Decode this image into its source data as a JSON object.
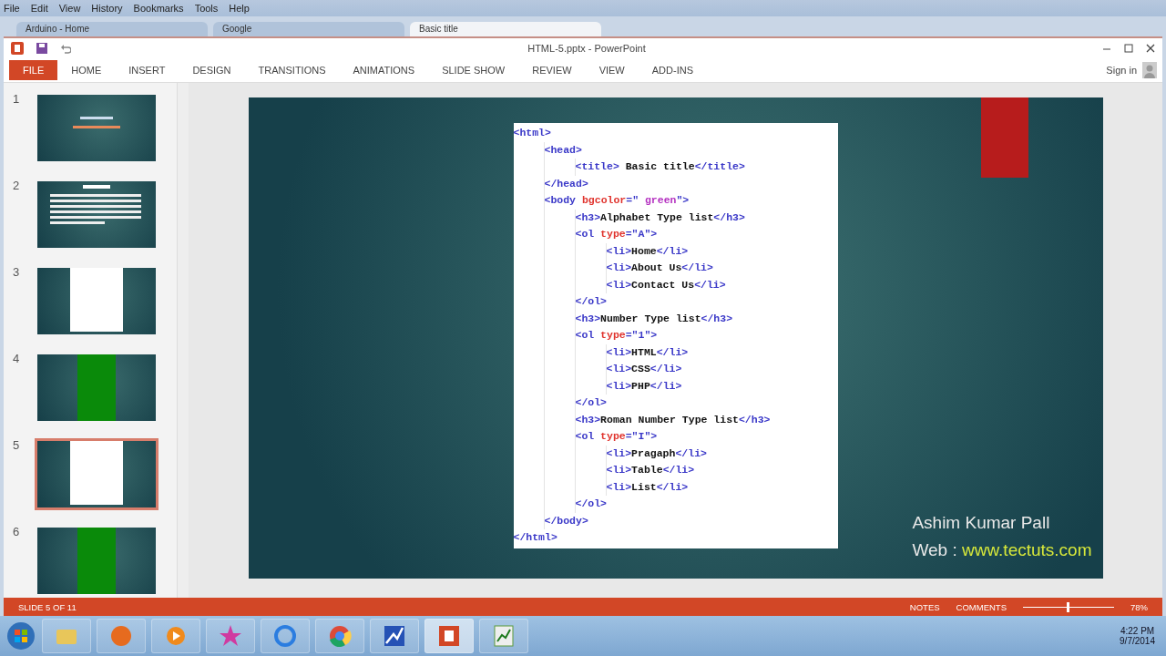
{
  "browser": {
    "menu": [
      "File",
      "Edit",
      "View",
      "History",
      "Bookmarks",
      "Tools",
      "Help"
    ],
    "tabs": [
      {
        "label": "Arduino - Home",
        "selected": false
      },
      {
        "label": "Google",
        "selected": false
      },
      {
        "label": "Basic title",
        "selected": true
      }
    ]
  },
  "window": {
    "title": "HTML-5.pptx - PowerPoint",
    "sign_in": "Sign in"
  },
  "ribbon": {
    "tabs": [
      {
        "label": "FILE",
        "selected": true
      },
      {
        "label": "HOME",
        "selected": false
      },
      {
        "label": "INSERT",
        "selected": false
      },
      {
        "label": "DESIGN",
        "selected": false
      },
      {
        "label": "TRANSITIONS",
        "selected": false
      },
      {
        "label": "ANIMATIONS",
        "selected": false
      },
      {
        "label": "SLIDE SHOW",
        "selected": false
      },
      {
        "label": "REVIEW",
        "selected": false
      },
      {
        "label": "VIEW",
        "selected": false
      },
      {
        "label": "ADD-INS",
        "selected": false
      }
    ]
  },
  "thumbnails": [
    {
      "number": "1",
      "kind": "title",
      "selected": false
    },
    {
      "number": "2",
      "kind": "text",
      "selected": false
    },
    {
      "number": "3",
      "kind": "code",
      "selected": false
    },
    {
      "number": "4",
      "kind": "green",
      "selected": false
    },
    {
      "number": "5",
      "kind": "code",
      "selected": true
    },
    {
      "number": "6",
      "kind": "green",
      "selected": false
    }
  ],
  "slide": {
    "code": [
      {
        "tokens": [
          {
            "kind": "tag",
            "text": "<html>"
          }
        ],
        "children": [
          {
            "tokens": [
              {
                "kind": "tag",
                "text": "<head>"
              }
            ],
            "children": [
              {
                "tokens": [
                  {
                    "kind": "tag",
                    "text": "<title>"
                  },
                  {
                    "kind": "text",
                    "text": " Basic title"
                  },
                  {
                    "kind": "tag",
                    "text": "</title>"
                  }
                ]
              }
            ]
          },
          {
            "tokens": [
              {
                "kind": "tag",
                "text": "</head>"
              }
            ]
          },
          {
            "tokens": [
              {
                "kind": "tag",
                "text": "<body "
              },
              {
                "kind": "attr",
                "text": "bgcolor"
              },
              {
                "kind": "tag",
                "text": "=\""
              },
              {
                "kind": "value",
                "text": " green"
              },
              {
                "kind": "tag",
                "text": "\">"
              }
            ],
            "children": [
              {
                "tokens": [
                  {
                    "kind": "tag",
                    "text": "<h3>"
                  },
                  {
                    "kind": "text",
                    "text": "Alphabet Type list"
                  },
                  {
                    "kind": "tag",
                    "text": "</h3>"
                  }
                ]
              },
              {
                "tokens": [
                  {
                    "kind": "tag",
                    "text": "<ol "
                  },
                  {
                    "kind": "attr",
                    "text": "type"
                  },
                  {
                    "kind": "tag",
                    "text": "=\"A\">"
                  }
                ],
                "children": [
                  {
                    "tokens": [
                      {
                        "kind": "tag",
                        "text": "<li>"
                      },
                      {
                        "kind": "text",
                        "text": "Home"
                      },
                      {
                        "kind": "tag",
                        "text": "</li>"
                      }
                    ]
                  },
                  {
                    "tokens": [
                      {
                        "kind": "tag",
                        "text": "<li>"
                      },
                      {
                        "kind": "text",
                        "text": "About Us"
                      },
                      {
                        "kind": "tag",
                        "text": "</li>"
                      }
                    ]
                  },
                  {
                    "tokens": [
                      {
                        "kind": "tag",
                        "text": "<li>"
                      },
                      {
                        "kind": "text",
                        "text": "Contact Us"
                      },
                      {
                        "kind": "tag",
                        "text": "</li>"
                      }
                    ]
                  }
                ]
              },
              {
                "tokens": [
                  {
                    "kind": "tag",
                    "text": "</ol>"
                  }
                ]
              },
              {
                "tokens": [
                  {
                    "kind": "tag",
                    "text": "<h3>"
                  },
                  {
                    "kind": "text",
                    "text": "Number Type list"
                  },
                  {
                    "kind": "tag",
                    "text": "</h3>"
                  }
                ]
              },
              {
                "tokens": [
                  {
                    "kind": "tag",
                    "text": "<ol "
                  },
                  {
                    "kind": "attr",
                    "text": "type"
                  },
                  {
                    "kind": "tag",
                    "text": "=\"1\">"
                  }
                ],
                "children": [
                  {
                    "tokens": [
                      {
                        "kind": "tag",
                        "text": "<li>"
                      },
                      {
                        "kind": "text",
                        "text": "HTML"
                      },
                      {
                        "kind": "tag",
                        "text": "</li>"
                      }
                    ]
                  },
                  {
                    "tokens": [
                      {
                        "kind": "tag",
                        "text": "<li>"
                      },
                      {
                        "kind": "text",
                        "text": "CSS"
                      },
                      {
                        "kind": "tag",
                        "text": "</li>"
                      }
                    ]
                  },
                  {
                    "tokens": [
                      {
                        "kind": "tag",
                        "text": "<li>"
                      },
                      {
                        "kind": "text",
                        "text": "PHP"
                      },
                      {
                        "kind": "tag",
                        "text": "</li>"
                      }
                    ]
                  }
                ]
              },
              {
                "tokens": [
                  {
                    "kind": "tag",
                    "text": "</ol>"
                  }
                ]
              },
              {
                "tokens": [
                  {
                    "kind": "tag",
                    "text": "<h3>"
                  },
                  {
                    "kind": "text",
                    "text": "Roman Number Type list"
                  },
                  {
                    "kind": "tag",
                    "text": "</h3>"
                  }
                ]
              },
              {
                "tokens": [
                  {
                    "kind": "tag",
                    "text": "<ol "
                  },
                  {
                    "kind": "attr",
                    "text": "type"
                  },
                  {
                    "kind": "tag",
                    "text": "=\"I\">"
                  }
                ],
                "children": [
                  {
                    "tokens": [
                      {
                        "kind": "tag",
                        "text": "<li>"
                      },
                      {
                        "kind": "text",
                        "text": "Pragaph"
                      },
                      {
                        "kind": "tag",
                        "text": "</li>"
                      }
                    ]
                  },
                  {
                    "tokens": [
                      {
                        "kind": "tag",
                        "text": "<li>"
                      },
                      {
                        "kind": "text",
                        "text": "Table"
                      },
                      {
                        "kind": "tag",
                        "text": "</li>"
                      }
                    ]
                  },
                  {
                    "tokens": [
                      {
                        "kind": "tag",
                        "text": "<li>"
                      },
                      {
                        "kind": "text",
                        "text": "List"
                      },
                      {
                        "kind": "tag",
                        "text": "</li>"
                      }
                    ]
                  }
                ]
              },
              {
                "tokens": [
                  {
                    "kind": "tag",
                    "text": "</ol>"
                  }
                ]
              }
            ]
          },
          {
            "tokens": [
              {
                "kind": "tag",
                "text": "</body>"
              }
            ]
          }
        ]
      },
      {
        "tokens": [
          {
            "kind": "tag",
            "text": "</html>"
          }
        ]
      }
    ],
    "author": "Ashim Kumar Pall",
    "web_label": "Web : ",
    "web_url": "www.tectuts.com"
  },
  "status_bar": {
    "slide_info": "SLIDE 5 OF 11",
    "notes": "NOTES",
    "comments": "COMMENTS",
    "zoom": "78%",
    "zoom_slider": {
      "level": 0.5
    }
  },
  "taskbar": {
    "apps": [
      {
        "kind": "folder",
        "selected": false
      },
      {
        "kind": "firefox",
        "selected": false
      },
      {
        "kind": "player",
        "selected": false
      },
      {
        "kind": "star",
        "selected": false
      },
      {
        "kind": "ie",
        "selected": false
      },
      {
        "kind": "chrome",
        "selected": false
      },
      {
        "kind": "chart",
        "selected": false
      },
      {
        "kind": "powerpoint",
        "selected": true
      },
      {
        "kind": "sheet",
        "selected": false
      }
    ],
    "time": "4:22 PM",
    "date": "9/7/2014"
  }
}
